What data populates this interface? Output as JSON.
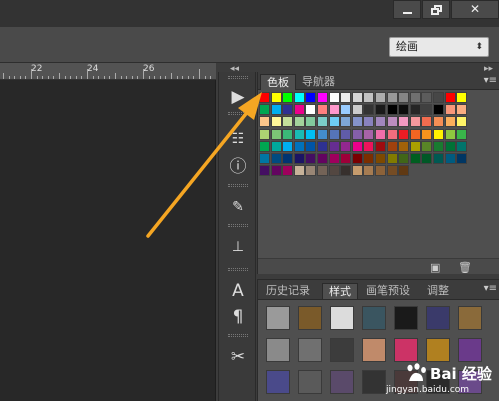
{
  "window": {
    "min_label": "",
    "max_label": "",
    "close_icon": "close-icon"
  },
  "options": {
    "workspace_value": "绘画"
  },
  "ruler": {
    "ticks": [
      "22",
      "24",
      "26"
    ]
  },
  "swatches_panel": {
    "tabs": [
      "色板",
      "导航器"
    ],
    "active_tab": "色板",
    "rows": [
      [
        "#ff0000",
        "#ffff00",
        "#00ff00",
        "#00ffff",
        "#0000ff",
        "#ff00ff",
        "#ffffff",
        "#ebebeb",
        "#d6d6d6",
        "#c2c2c2",
        "#adadad",
        "#999999",
        "#858585",
        "#707070",
        "#5c5c5c",
        "#474747",
        "#ff0000",
        "#ffff00"
      ],
      [
        "#00a651",
        "#00aeef",
        "#2e3192",
        "#ec008c",
        "#ffffff",
        "#ff7f7f",
        "#ff99cc",
        "#99ccff",
        "#cccccc",
        "#333333",
        "#1a1a1a",
        "#000000",
        "#0d0d0d",
        "#262626",
        "#404040",
        "#000000",
        "#f7977a",
        "#f9ad81"
      ],
      [
        "#fdc68a",
        "#fff79a",
        "#c4df9b",
        "#a3d39c",
        "#82ca9d",
        "#7bcdc8",
        "#6ecff6",
        "#7ea7d8",
        "#8493ca",
        "#8882be",
        "#a187be",
        "#bc8dbf",
        "#f49ac2",
        "#f6989d",
        "#f26c4f",
        "#f68e55",
        "#fbaf5c",
        "#fff467"
      ],
      [
        "#acd372",
        "#7cc576",
        "#3bb878",
        "#1abbb4",
        "#00bff3",
        "#438ccb",
        "#5574b9",
        "#605ca8",
        "#855fa8",
        "#a763a8",
        "#f06eaa",
        "#f26d7d",
        "#ed1c24",
        "#f26522",
        "#f7941d",
        "#fff200",
        "#8dc73f",
        "#39b54a"
      ],
      [
        "#00a651",
        "#00a99d",
        "#00aeef",
        "#0072bc",
        "#0054a6",
        "#2e3192",
        "#662d91",
        "#92278f",
        "#ec008c",
        "#ed145b",
        "#9e0b0f",
        "#a0410d",
        "#a36209",
        "#aba000",
        "#598527",
        "#197b30",
        "#007236",
        "#00746b"
      ],
      [
        "#0076a3",
        "#004b80",
        "#003471",
        "#1b1464",
        "#440e62",
        "#630460",
        "#9e005d",
        "#9e0039",
        "#790000",
        "#7b2e00",
        "#7d4900",
        "#827b00",
        "#406618",
        "#005e20",
        "#005826",
        "#005952",
        "#005b7f",
        "#003663"
      ],
      [
        "#440e62",
        "#630460",
        "#9e005d",
        "#c7b299",
        "#998675",
        "#736357",
        "#534741",
        "#37302d",
        "#c69c6d",
        "#a67c52",
        "#8c6239",
        "#754c24",
        "#603913"
      ]
    ]
  },
  "styles_panel": {
    "tabs": [
      "历史记录",
      "样式",
      "画笔预设",
      "调整"
    ],
    "active_tab": "样式",
    "styles": [
      "#9a9a9a",
      "#7a5a2a",
      "#dcdcdc",
      "#3a5560",
      "#1a1a1a",
      "#3a3a6a",
      "#8a6a3a",
      "#8a8a8a",
      "#707070",
      "#3c3c3c",
      "#c08a6a",
      "#cc3366",
      "#b08020",
      "#6a3a8a",
      "#4a4a8a",
      "#5a5a5a",
      "#5a4a6a",
      "#333333",
      "#4a3a3a",
      "#2a2a2a",
      "#6a4a8a"
    ]
  },
  "watermark": {
    "brand": "Bai 经验",
    "url": "jingyan.baidu.com"
  },
  "colors": {
    "arrow": "#f5a623",
    "accent": "#4a4a4a"
  }
}
